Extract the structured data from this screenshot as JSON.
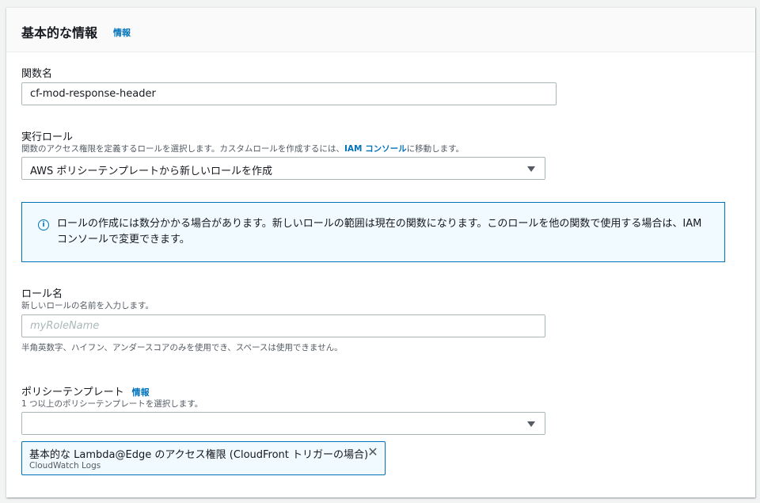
{
  "header": {
    "title": "基本的な情報",
    "info_link": "情報"
  },
  "function_name": {
    "label": "関数名",
    "value": "cf-mod-response-header"
  },
  "execution_role": {
    "label": "実行ロール",
    "description_prefix": "関数のアクセス権限を定義するロールを選択します。カスタムロールを作成するには、",
    "description_link": "IAM コンソール",
    "description_suffix": "に移動します。",
    "selected": "AWS ポリシーテンプレートから新しいロールを作成"
  },
  "alert": {
    "icon": "info-icon",
    "text": "ロールの作成には数分かかる場合があります。新しいロールの範囲は現在の関数になります。このロールを他の関数で使用する場合は、IAM コンソールで変更できます。"
  },
  "role_name": {
    "label": "ロール名",
    "description": "新しいロールの名前を入力します。",
    "placeholder": "myRoleName",
    "hint": "半角英数字、ハイフン、アンダースコアのみを使用でき、スペースは使用できません。"
  },
  "policy_templates": {
    "label": "ポリシーテンプレート",
    "info_link": "情報",
    "description": "1 つ以上のポリシーテンプレートを選択します。",
    "selected": "",
    "token": {
      "label": "基本的な Lambda@Edge のアクセス権限 (CloudFront トリガーの場合)",
      "sublabel": "CloudWatch Logs"
    }
  },
  "colors": {
    "link": "#0073bb",
    "alert_bg": "#f1faff",
    "border": "#aab7b8"
  }
}
